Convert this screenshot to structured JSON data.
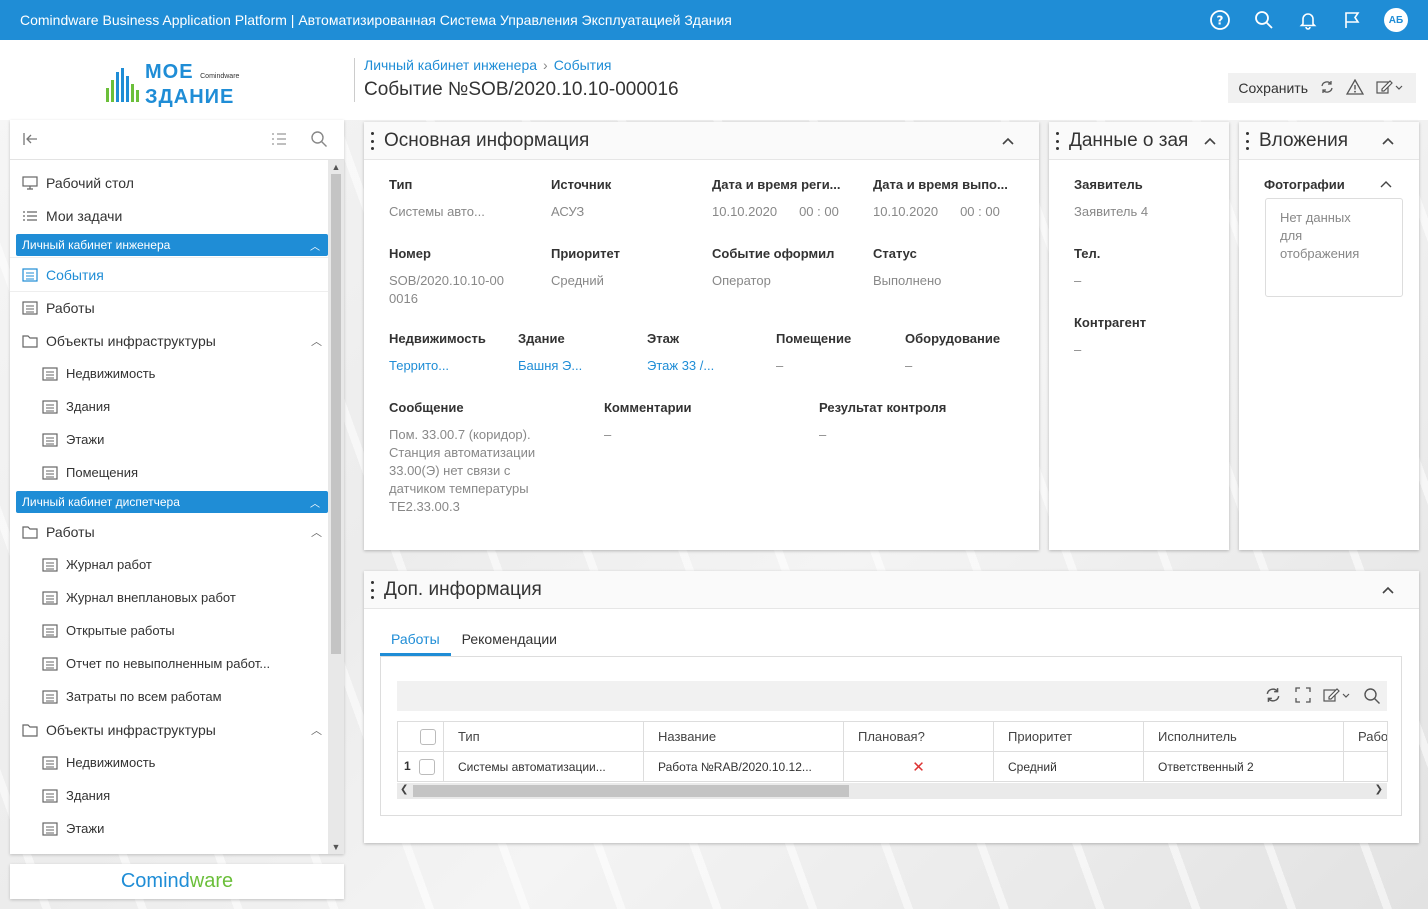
{
  "topbar": {
    "title": "Comindware Business Application Platform  |  Автоматизированная Система Управления Эксплуатацией Здания",
    "avatar": "АБ",
    "icons": [
      "help-icon",
      "search-icon",
      "bell-icon",
      "flag-icon"
    ]
  },
  "logo": {
    "line1": "МОЕ",
    "brand": "Comindware",
    "line2": "ЗДАНИЕ"
  },
  "header": {
    "crumb1": "Личный кабинет инженера",
    "crumb2": "События",
    "title": "Событие №SOB/2020.10.10-000016",
    "save": "Сохранить"
  },
  "sidebar": {
    "desk": "Рабочий стол",
    "tasks": "Мои задачи",
    "sec1": "Личный кабинет инженера",
    "events": "События",
    "works": "Работы",
    "infra": "Объекты инфраструктуры",
    "realty": "Недвижимость",
    "buildings": "Здания",
    "floors": "Этажи",
    "rooms": "Помещения",
    "sec2": "Личный кабинет диспетчера",
    "works2": "Работы",
    "journal": "Журнал работ",
    "unplanned": "Журнал внеплановых работ",
    "open": "Открытые работы",
    "report": "Отчет по невыполненным работ...",
    "costs": "Затраты по всем работам",
    "infra2": "Объекты инфраструктуры",
    "realty2": "Недвижимость",
    "buildings2": "Здания",
    "floors2": "Этажи"
  },
  "footer": {
    "brand1": "Comind",
    "brand2": "ware"
  },
  "main": {
    "title": "Основная информация",
    "f": [
      {
        "l": "Тип",
        "v": "Системы авто..."
      },
      {
        "l": "Источник",
        "v": "АСУЗ"
      },
      {
        "l": "Дата и время реги...",
        "v": "10.10.2020",
        "t": "00 : 00"
      },
      {
        "l": "Дата и время выпо...",
        "v": "10.10.2020",
        "t": "00 : 00"
      },
      {
        "l": "Номер",
        "v": "SOB/2020.10.10-00",
        "v2": "0016"
      },
      {
        "l": "Приоритет",
        "v": "Средний"
      },
      {
        "l": "Событие оформил",
        "v": "Оператор"
      },
      {
        "l": "Статус",
        "v": "Выполнено"
      },
      {
        "l": "Недвижимость",
        "v": "Террито..."
      },
      {
        "l": "Здание",
        "v": "Башня Э..."
      },
      {
        "l": "Этаж",
        "v": "Этаж 33 /..."
      },
      {
        "l": "Помещение",
        "v": "–"
      },
      {
        "l": "Оборудование",
        "v": "–"
      },
      {
        "l": "Сообщение",
        "lines": [
          "Пом. 33.00.7 (коридор).",
          "Станция автоматизации",
          "33.00(Э) нет связи с",
          "датчиком температуры",
          "TE2.33.00.3"
        ]
      },
      {
        "l": "Комментарии",
        "v": "–"
      },
      {
        "l": "Результат контроля",
        "v": "–"
      }
    ]
  },
  "applicant": {
    "title": "Данные о заявителе",
    "l1": "Заявитель",
    "v1": "Заявитель 4",
    "l2": "Тел.",
    "v2": "–",
    "l3": "Контрагент",
    "v3": "–"
  },
  "attach": {
    "title": "Вложения",
    "l": "Фотографии",
    "empty1": "Нет данных",
    "empty2": "для",
    "empty3": "отображения"
  },
  "extra": {
    "title": "Доп. информация",
    "tab1": "Работы",
    "tab2": "Рекомендации",
    "cols": [
      "Тип",
      "Название",
      "Плановая?",
      "Приоритет",
      "Исполнитель",
      "Работа"
    ],
    "row": {
      "n": "1",
      "type": "Системы автоматизации...",
      "name": "Работа №RAB/2020.10.12...",
      "planned": "✕",
      "prio": "Средний",
      "exec": "Ответственный 2"
    }
  }
}
